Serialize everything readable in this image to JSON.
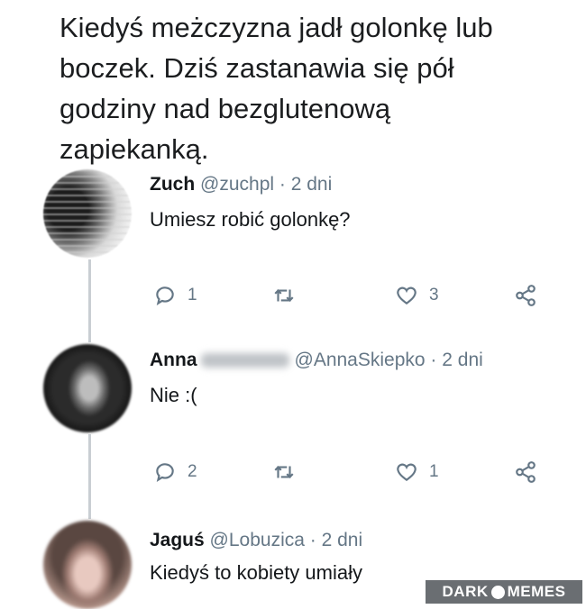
{
  "headline": "Kiedyś meżczyzna jadł golonkę lub boczek. Dziś zastanawia się pół godziny nad bezglutenową zapiekanką.",
  "replies": [
    {
      "name": "Zuch",
      "handle": "@zuchpl",
      "time": "· 2 dni",
      "text": "Umiesz robić golonkę?",
      "reply_count": "1",
      "like_count": "3"
    },
    {
      "name": "Anna",
      "surname_blurred": "Skiepko",
      "handle": "@AnnaSkiepko",
      "time": "· 2 dni",
      "text": "Nie :(",
      "reply_count": "2",
      "like_count": "1"
    },
    {
      "name": "Jaguś",
      "handle": "@Lobuzica",
      "time": "· 2 dni",
      "text": "Kiedyś to kobiety umiały"
    }
  ],
  "watermark": {
    "left": "DARK",
    "right": "MEMES"
  },
  "icons": {
    "reply": "reply-icon",
    "retweet": "retweet-icon",
    "like": "heart-icon",
    "share": "share-icon"
  },
  "colors": {
    "text": "#14171a",
    "meta": "#657786",
    "thread_line": "#c9ced3"
  }
}
